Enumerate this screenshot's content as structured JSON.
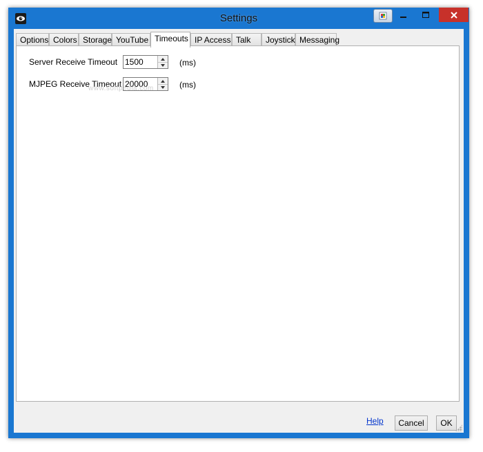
{
  "window": {
    "title": "Settings",
    "accent": "#1a77d1",
    "close_color": "#c7312a"
  },
  "tabs": [
    {
      "label": "Options"
    },
    {
      "label": "Colors"
    },
    {
      "label": "Storage"
    },
    {
      "label": "YouTube"
    },
    {
      "label": "Timeouts",
      "active": true
    },
    {
      "label": "IP Access"
    },
    {
      "label": "Talk"
    },
    {
      "label": "Joystick"
    },
    {
      "label": "Messaging"
    }
  ],
  "timeouts": {
    "server_receive": {
      "label": "Server Receive Timeout",
      "value": "1500",
      "unit": "(ms)"
    },
    "mjpeg_receive": {
      "label": "MJPEG Receive Timeout",
      "value": "20000",
      "unit": "(ms)"
    }
  },
  "watermark": "www.softpedia.com",
  "footer": {
    "help": "Help",
    "cancel": "Cancel",
    "ok": "OK"
  },
  "icons": {
    "app": "eye-icon",
    "minimize": "minimize-icon",
    "maximize": "maximize-icon",
    "close": "close-icon",
    "spin_up": "chevron-up-icon",
    "spin_down": "chevron-down-icon"
  }
}
